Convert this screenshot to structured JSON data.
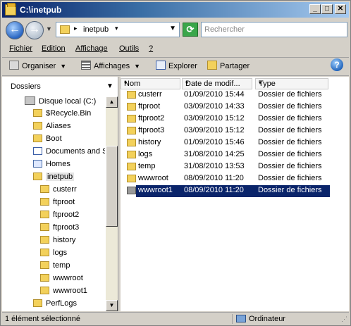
{
  "window": {
    "title": "C:\\inetpub",
    "controls": [
      "_",
      "□",
      "✕"
    ]
  },
  "address": {
    "path": "inetpub",
    "search_placeholder": "Rechercher"
  },
  "menu": [
    "Fichier",
    "Edition",
    "Affichage",
    "Outils",
    "?"
  ],
  "toolbar": {
    "organise": "Organiser",
    "views": "Affichages",
    "explore": "Explorer",
    "share": "Partager"
  },
  "nav": {
    "header": "Dossiers",
    "items": [
      {
        "label": "Disque local (C:)",
        "icon": "disk-icon"
      },
      {
        "label": "$Recycle.Bin",
        "icon": "folder-icon"
      },
      {
        "label": "Aliases",
        "icon": "folder-icon"
      },
      {
        "label": "Boot",
        "icon": "folder-icon"
      },
      {
        "label": "Documents and S",
        "icon": "documents-icon"
      },
      {
        "label": "Homes",
        "icon": "homes-icon"
      },
      {
        "label": "inetpub",
        "icon": "folder-icon"
      },
      {
        "label": "custerr",
        "icon": "folder-icon"
      },
      {
        "label": "ftproot",
        "icon": "folder-icon"
      },
      {
        "label": "ftproot2",
        "icon": "folder-icon"
      },
      {
        "label": "ftproot3",
        "icon": "folder-icon"
      },
      {
        "label": "history",
        "icon": "folder-icon"
      },
      {
        "label": "logs",
        "icon": "folder-icon"
      },
      {
        "label": "temp",
        "icon": "folder-icon"
      },
      {
        "label": "wwwroot",
        "icon": "folder-icon"
      },
      {
        "label": "wwwroot1",
        "icon": "folder-icon"
      },
      {
        "label": "PerfLogs",
        "icon": "folder-icon"
      }
    ]
  },
  "files": {
    "columns": [
      "Nom",
      "Date de modif...",
      "Type"
    ],
    "rows": [
      {
        "name": "custerr",
        "date": "01/09/2010 15:44",
        "type": "Dossier de fichiers"
      },
      {
        "name": "ftproot",
        "date": "03/09/2010 14:33",
        "type": "Dossier de fichiers"
      },
      {
        "name": "ftproot2",
        "date": "03/09/2010 15:12",
        "type": "Dossier de fichiers"
      },
      {
        "name": "ftproot3",
        "date": "03/09/2010 15:12",
        "type": "Dossier de fichiers"
      },
      {
        "name": "history",
        "date": "01/09/2010 15:46",
        "type": "Dossier de fichiers"
      },
      {
        "name": "logs",
        "date": "31/08/2010 14:25",
        "type": "Dossier de fichiers"
      },
      {
        "name": "temp",
        "date": "31/08/2010 13:53",
        "type": "Dossier de fichiers"
      },
      {
        "name": "wwwroot",
        "date": "08/09/2010 11:20",
        "type": "Dossier de fichiers"
      },
      {
        "name": "wwwroot1",
        "date": "08/09/2010 11:20",
        "type": "Dossier de fichiers"
      }
    ]
  },
  "status": {
    "left": "1 élément sélectionné",
    "right": "Ordinateur"
  }
}
